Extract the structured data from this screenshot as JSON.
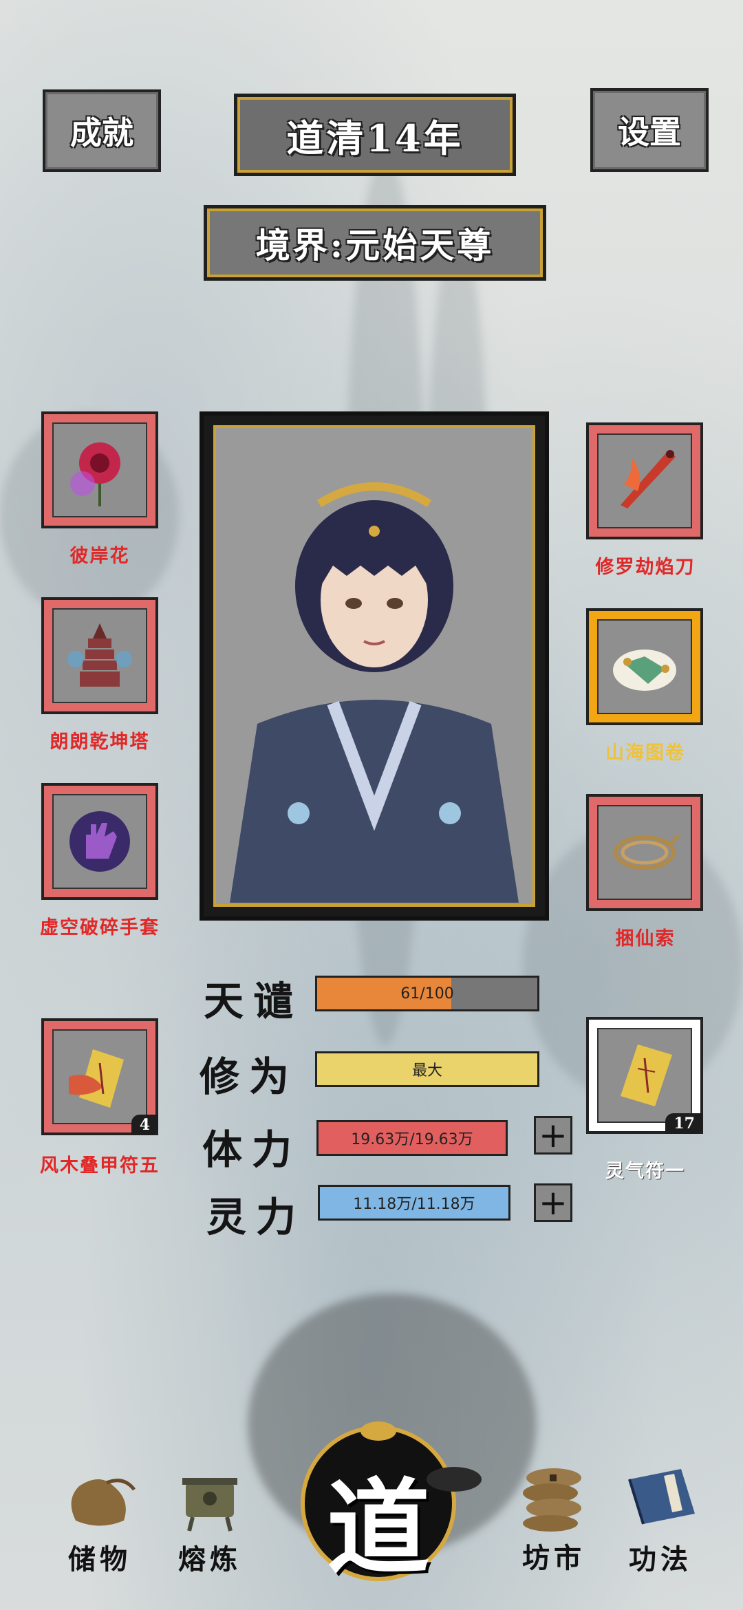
{
  "header": {
    "achievements_label": "成就",
    "year_label": "道清14年",
    "settings_label": "设置",
    "realm_label": "境界:元始天尊"
  },
  "equipment_left": [
    {
      "label": "彼岸花",
      "icon": "red-lily-flower-icon"
    },
    {
      "label": "朗朗乾坤塔",
      "icon": "pagoda-icon"
    },
    {
      "label": "虚空破碎手套",
      "icon": "void-glove-icon"
    }
  ],
  "equipment_right": [
    {
      "label": "修罗劫焰刀",
      "icon": "flame-blade-icon"
    },
    {
      "label": "山海图卷",
      "icon": "scroll-map-icon"
    },
    {
      "label": "捆仙索",
      "icon": "rope-icon"
    }
  ],
  "talisman_left": {
    "label": "风木叠甲符五",
    "count": "4",
    "icon": "talisman-icon"
  },
  "talisman_right": {
    "label": "灵气符一",
    "count": "17",
    "icon": "talisman-icon"
  },
  "stats": {
    "tribulation": {
      "label": "天谴",
      "value_text": "61/100",
      "fraction": 0.61,
      "color": "#e8873a"
    },
    "cultivation": {
      "label": "修为",
      "value_text": "最大",
      "fraction": 1.0,
      "color": "#e9d36a"
    },
    "stamina": {
      "label": "体力",
      "value_text": "19.63万/19.63万",
      "fraction": 1.0,
      "color": "#e25f5f"
    },
    "spirit": {
      "label": "灵力",
      "value_text": "11.18万/11.18万",
      "fraction": 1.0,
      "color": "#7fb6e3"
    },
    "plus_symbol": "+"
  },
  "nav": {
    "storage": "储物",
    "smelting": "熔炼",
    "dao": "道",
    "market": "坊市",
    "skills": "功法"
  }
}
